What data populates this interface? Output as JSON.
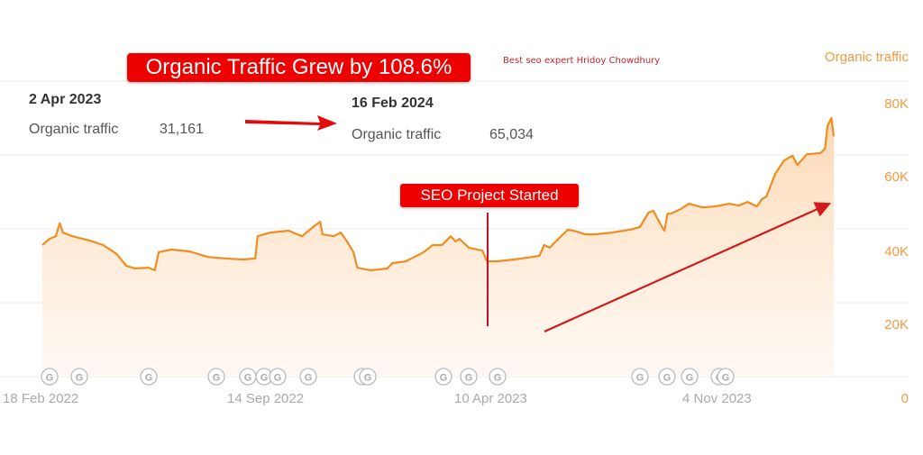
{
  "headline": "Organic Traffic Grew by 108.6%",
  "credit": "Best seo expert Hridoy Chowdhury",
  "series_name": "Organic traffic",
  "start_point": {
    "date": "2 Apr 2023",
    "label": "Organic traffic",
    "value": "31,161"
  },
  "end_point": {
    "date": "16 Feb 2024",
    "label": "Organic traffic",
    "value": "65,034"
  },
  "annotation": "SEO Project Started",
  "colors": {
    "line": "#f28c1e",
    "fill": "#fde3c8",
    "annotation": "#e00000",
    "grid": "#ececec",
    "axis_text": "#f39a3f",
    "x_text": "#aaaaaa"
  },
  "chart_data": {
    "type": "area",
    "title": "Organic Traffic Grew by 108.6%",
    "xlabel": "",
    "ylabel": "Organic traffic",
    "ylim": [
      0,
      80000
    ],
    "yticks": [
      "80K",
      "60K",
      "40K",
      "20K",
      "0"
    ],
    "ytick_values": [
      80000,
      60000,
      40000,
      20000,
      0
    ],
    "xticks": [
      "18 Feb 2022",
      "14 Sep 2022",
      "10 Apr 2023",
      "4 Nov 2023"
    ],
    "grid": true,
    "legend": "top-right",
    "series": [
      {
        "name": "Organic traffic",
        "x_fraction": [
          0,
          0.009,
          0.017,
          0.022,
          0.026,
          0.038,
          0.06,
          0.077,
          0.094,
          0.106,
          0.117,
          0.134,
          0.142,
          0.147,
          0.163,
          0.186,
          0.209,
          0.231,
          0.254,
          0.269,
          0.272,
          0.288,
          0.311,
          0.328,
          0.345,
          0.351,
          0.354,
          0.368,
          0.377,
          0.385,
          0.393,
          0.398,
          0.414,
          0.425,
          0.436,
          0.442,
          0.459,
          0.47,
          0.482,
          0.493,
          0.505,
          0.516,
          0.522,
          0.527,
          0.539,
          0.556,
          0.562,
          0.562,
          0.573,
          0.596,
          0.619,
          0.628,
          0.634,
          0.641,
          0.652,
          0.664,
          0.675,
          0.686,
          0.698,
          0.72,
          0.743,
          0.755,
          0.766,
          0.772,
          0.783,
          0.786,
          0.79,
          0.794,
          0.806,
          0.817,
          0.834,
          0.851,
          0.868,
          0.88,
          0.891,
          0.903,
          0.909,
          0.915,
          0.926,
          0.937,
          0.948,
          0.954,
          0.966,
          0.983,
          0.989,
          0.992,
          0.997,
          1.0
        ],
        "values": [
          35600,
          37300,
          38000,
          41500,
          39000,
          38000,
          36800,
          35600,
          33200,
          30000,
          29300,
          29500,
          28800,
          33700,
          34400,
          33900,
          32400,
          32000,
          31700,
          32000,
          38000,
          39000,
          39500,
          38000,
          41000,
          41900,
          38500,
          38000,
          39000,
          36600,
          33700,
          29500,
          28800,
          29000,
          29300,
          30700,
          31200,
          32400,
          33700,
          35600,
          35600,
          38000,
          36600,
          37300,
          34900,
          34100,
          31161,
          31200,
          31200,
          31700,
          32400,
          32700,
          35600,
          34900,
          37300,
          39800,
          39300,
          38500,
          38500,
          39000,
          39800,
          40500,
          44400,
          44900,
          40500,
          39500,
          44100,
          44100,
          45300,
          46800,
          45800,
          46100,
          46800,
          46300,
          47300,
          46100,
          48000,
          48800,
          54900,
          58500,
          59800,
          57300,
          60200,
          60500,
          61700,
          67800,
          70000,
          65034
        ]
      }
    ]
  }
}
